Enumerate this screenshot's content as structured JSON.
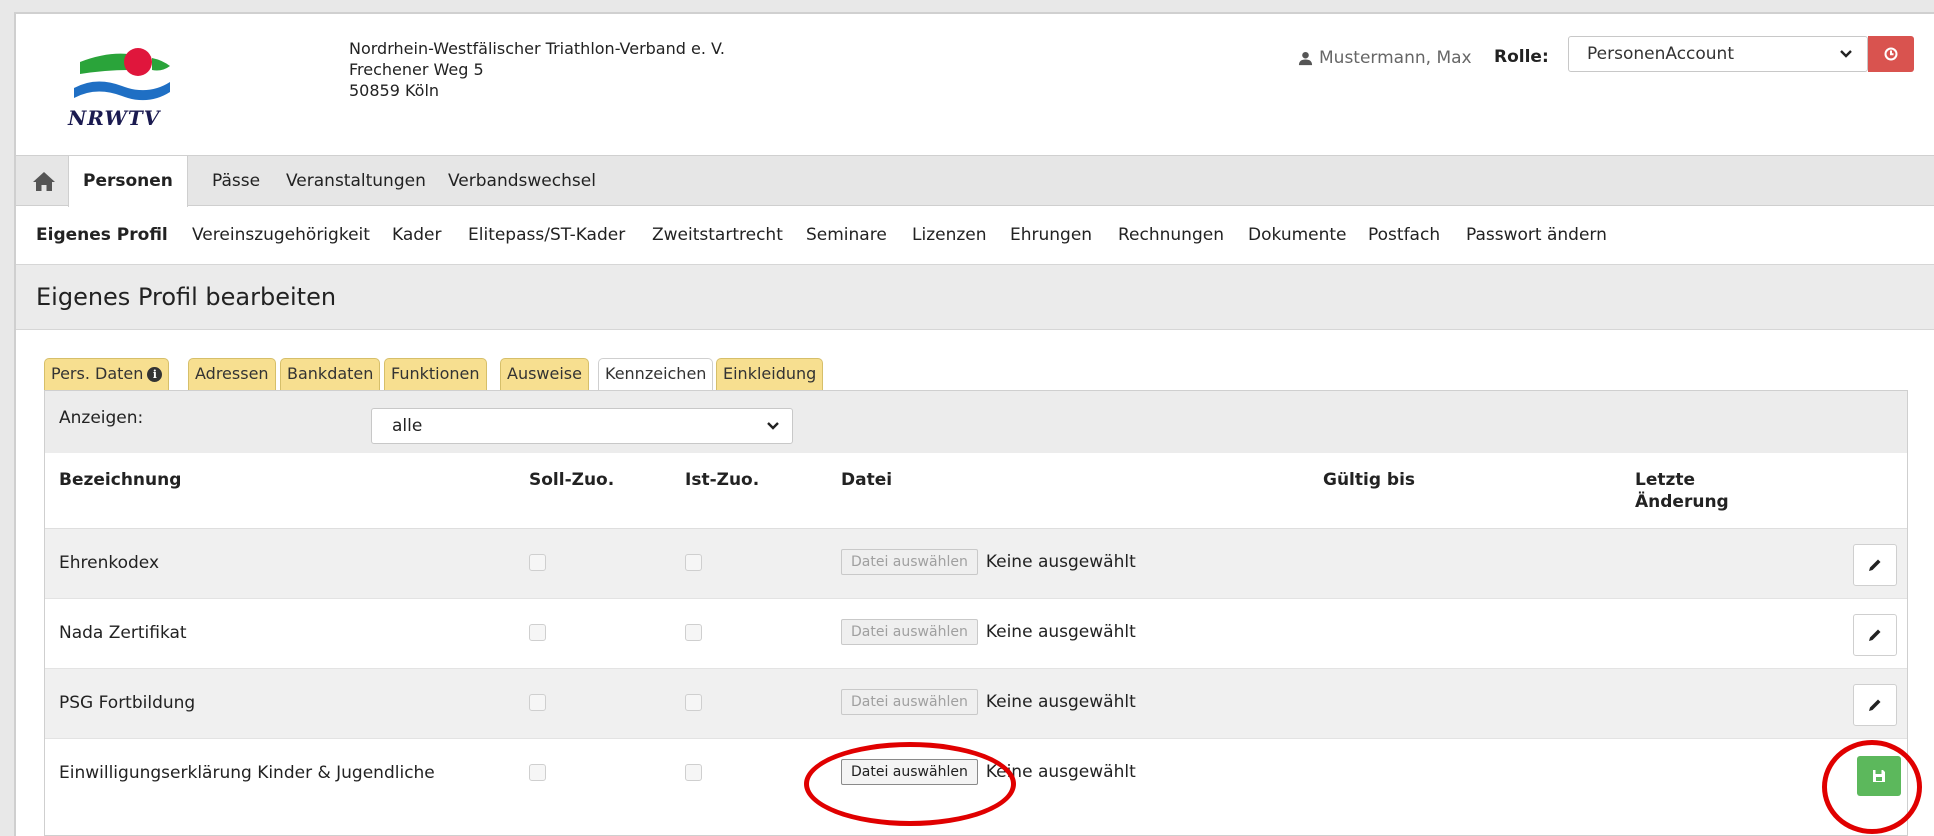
{
  "header": {
    "logo_text": "NRWTV",
    "org_lines": [
      "Nordrhein-Westfälischer Triathlon-Verband e. V.",
      "Frechener Weg 5",
      "50859 Köln"
    ],
    "user_name": "Mustermann, Max",
    "rolle_label": "Rolle:",
    "rolle_value": "PersonenAccount"
  },
  "mainnav": {
    "tabs": [
      "Personen",
      "Pässe",
      "Veranstaltungen",
      "Verbandswechsel"
    ],
    "active": "Personen"
  },
  "subnav": {
    "items": [
      "Eigenes Profil",
      "Vereinszugehörigkeit",
      "Kader",
      "Elitepass/ST-Kader",
      "Zweitstartrecht",
      "Seminare",
      "Lizenzen",
      "Ehrungen",
      "Rechnungen",
      "Dokumente",
      "Postfach",
      "Passwort ändern"
    ],
    "active": "Eigenes Profil"
  },
  "page_title": "Eigenes Profil bearbeiten",
  "tabs": {
    "items": [
      "Pers. Daten",
      "Adressen",
      "Bankdaten",
      "Funktionen",
      "Ausweise",
      "Kennzeichen",
      "Einkleidung"
    ],
    "active": "Kennzeichen"
  },
  "filter": {
    "label": "Anzeigen:",
    "value": "alle"
  },
  "table": {
    "headers": [
      "Bezeichnung",
      "Soll-Zuo.",
      "Ist-Zuo.",
      "Datei",
      "Gültig bis",
      "Letzte",
      "Änderung"
    ],
    "file_button_label": "Datei auswählen",
    "file_none_label": "Keine ausgewählt",
    "rows": [
      {
        "name": "Ehrenkodex"
      },
      {
        "name": "Nada Zertifikat"
      },
      {
        "name": "PSG Fortbildung"
      },
      {
        "name": "Einwilligungserklärung Kinder & Jugendliche"
      }
    ]
  },
  "colors": {
    "tab_yellow": "#f7df90",
    "save_green": "#5cb85c",
    "logout_red": "#d9534f",
    "annotation_red": "#e00000"
  }
}
